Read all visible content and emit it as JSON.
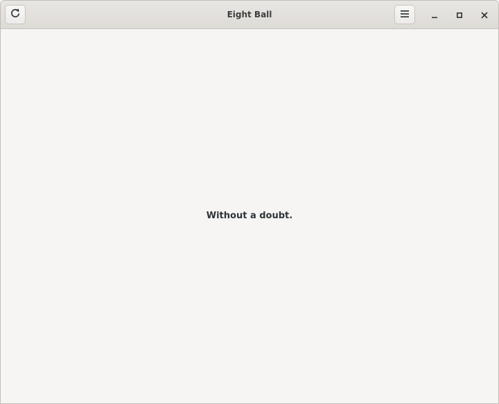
{
  "window": {
    "title": "Eight Ball"
  },
  "headerbar": {
    "left_button_icon": "refresh-icon",
    "right_button_icon": "hamburger-menu-icon",
    "window_controls": [
      "minimize-icon",
      "maximize-icon",
      "close-icon"
    ]
  },
  "main": {
    "answer": "Without a doubt."
  },
  "colors": {
    "background": "#f6f5f4",
    "headerbar": "#e1dedb",
    "text": "#2e3436"
  }
}
